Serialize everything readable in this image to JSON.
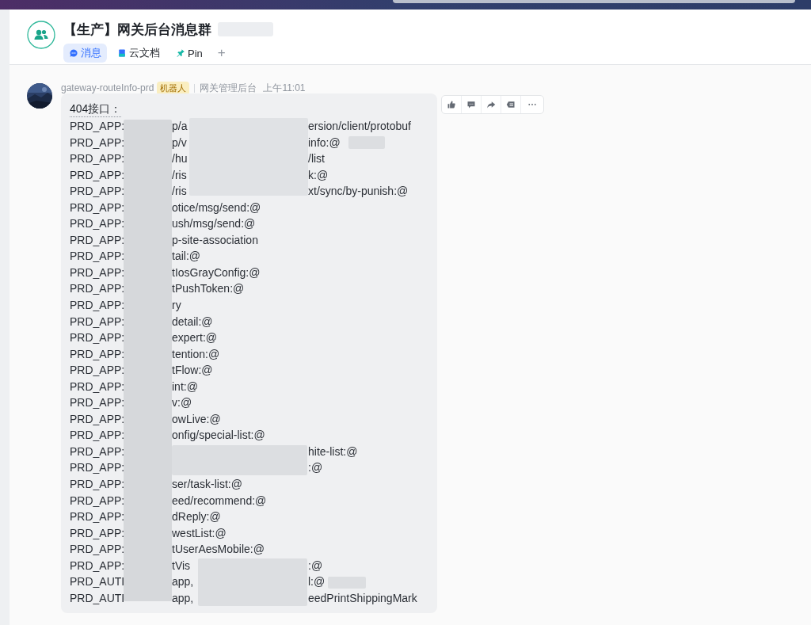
{
  "chat": {
    "title": "【生产】网关后台消息群",
    "tabs": [
      {
        "label": "消息",
        "kind": "chat",
        "selected": true
      },
      {
        "label": "云文档",
        "kind": "docs",
        "selected": false
      },
      {
        "label": "Pin",
        "kind": "pin",
        "selected": false
      }
    ],
    "add_tab": "+"
  },
  "message": {
    "sender": "gateway-routeInfo-prd",
    "badge": "机器人",
    "source": "网关管理后台",
    "time": "上午11:01",
    "heading": "404接口：",
    "lines": [
      {
        "head": "PRD_APP:",
        "mid": "p/a",
        "tail": "ersion/client/protobuf"
      },
      {
        "head": "PRD_APP:",
        "mid": "p/v",
        "tail": "info:@"
      },
      {
        "head": "PRD_APP:",
        "mid": "/hu",
        "tail": "/list"
      },
      {
        "head": "PRD_APP:",
        "mid": "/ris",
        "tail": "k:@"
      },
      {
        "head": "PRD_APP:",
        "mid": "/ris",
        "tail": "xt/sync/by-punish:@"
      },
      {
        "head": "PRD_APP:",
        "mid": "otice/msg/send:@"
      },
      {
        "head": "PRD_APP:",
        "mid": "ush/msg/send:@"
      },
      {
        "head": "PRD_APP:",
        "mid": "p-site-association"
      },
      {
        "head": "PRD_APP:",
        "mid": "tail:@"
      },
      {
        "head": "PRD_APP:",
        "mid": "tIosGrayConfig:@"
      },
      {
        "head": "PRD_APP:",
        "mid": "tPushToken:@"
      },
      {
        "head": "PRD_APP:",
        "mid": "ry"
      },
      {
        "head": "PRD_APP:",
        "mid": "detail:@"
      },
      {
        "head": "PRD_APP:",
        "mid": "expert:@"
      },
      {
        "head": "PRD_APP:",
        "mid": "tention:@"
      },
      {
        "head": "PRD_APP:",
        "mid": "tFlow:@"
      },
      {
        "head": "PRD_APP:",
        "mid": "int:@"
      },
      {
        "head": "PRD_APP:",
        "mid": "v:@"
      },
      {
        "head": "PRD_APP:",
        "mid": "owLive:@"
      },
      {
        "head": "PRD_APP:",
        "mid": "onfig/special-list:@"
      },
      {
        "head": "PRD_APP:",
        "tail": "hite-list:@"
      },
      {
        "head": "PRD_APP:",
        "tail": ":@"
      },
      {
        "head": "PRD_APP:",
        "mid": "ser/task-list:@"
      },
      {
        "head": "PRD_APP:",
        "mid": "eed/recommend:@"
      },
      {
        "head": "PRD_APP:",
        "mid": "dReply:@"
      },
      {
        "head": "PRD_APP:",
        "mid": "westList:@"
      },
      {
        "head": "PRD_APP:",
        "mid": "tUserAesMobile:@"
      },
      {
        "head": "PRD_APP:",
        "mid": "tVis",
        "tail": ":@"
      },
      {
        "head": "PRD_AUTI",
        "mid": "app,",
        "tail": "l:@"
      },
      {
        "head": "PRD_AUTI",
        "mid": "app,",
        "tail": "eedPrintShippingMark"
      }
    ],
    "actions": [
      {
        "kind": "like"
      },
      {
        "kind": "reply"
      },
      {
        "kind": "forward"
      },
      {
        "kind": "quote"
      },
      {
        "kind": "more"
      }
    ]
  }
}
